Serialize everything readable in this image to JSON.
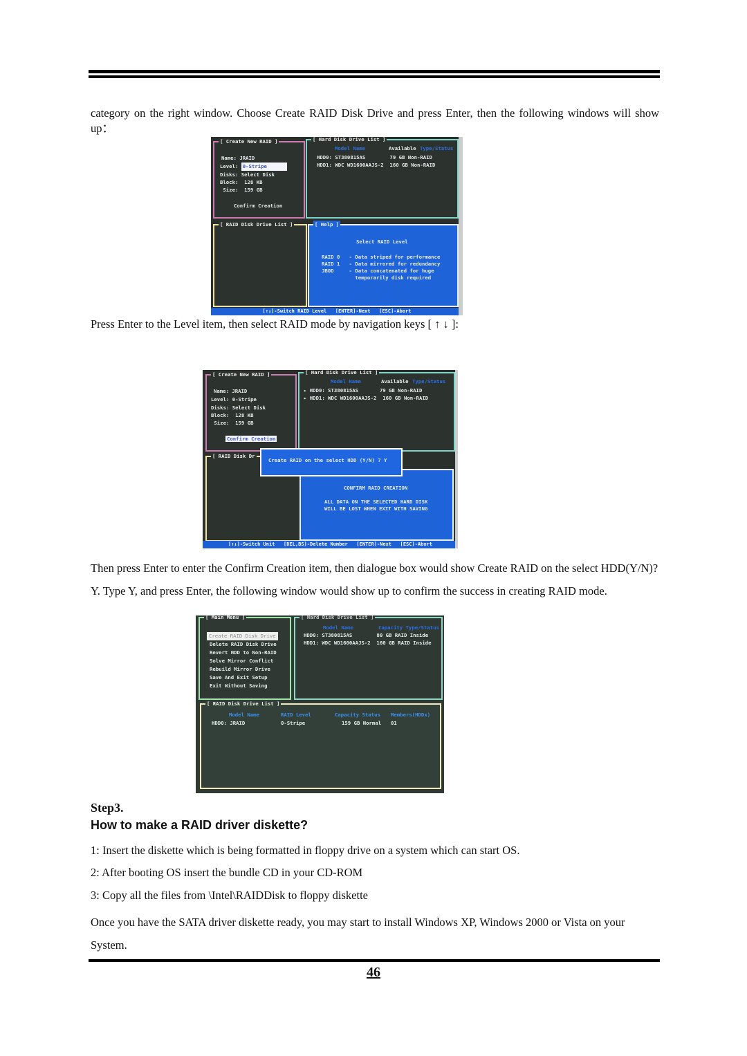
{
  "page": {
    "intro_text": "category on the right window. Choose Create RAID Disk Drive and press Enter, then the following windows will show up：",
    "caption_after_shot1": "Press Enter to the Level item, then select RAID mode by navigation keys [ ↑  ↓ ]:",
    "caption_after_shot2": "Then press Enter to enter the    Confirm Creation item, then dialogue box would show Create RAID on the select HDD(Y/N)?Y. Type Y, and press Enter, the following window would show up to confirm the success in creating RAID mode.",
    "step_label": "Step3.",
    "heading": "How to make a RAID driver diskette?",
    "steps": [
      "1: Insert the diskette which is being formatted in floppy drive on a system which can start OS.",
      "2: After booting OS insert the bundle CD in your CD-ROM",
      "3: Copy all the files from \\Intel\\RAIDDisk to floppy diskette"
    ],
    "closing_text": "Once you have the SATA driver diskette ready, you may start to install Windows XP, Windows 2000 or Vista on your System.",
    "page_number": "46"
  },
  "screenshot1": {
    "create_panel_title": "[ Create New RAID ]",
    "fields": {
      "name": "Name: JRAID",
      "level_label": "Level:",
      "level_value": "0-Stripe",
      "disks": "Disks: Select Disk",
      "block": "Block:  128 KB",
      "size": " Size:  159 GB"
    },
    "confirm": "Confirm Creation",
    "hdd_panel_title": "[ Hard Disk Drive List ]",
    "hdd_header_model": "Model Name",
    "hdd_header_available": "Available",
    "hdd_header_type": "Type/Status",
    "hdd_rows": [
      "HDD0: ST380815AS        79 GB Non-RAID",
      "HDD1: WDC WD1600AAJS-2  160 GB Non-RAID"
    ],
    "raid_list_title": "[ RAID Disk Drive List ]",
    "help_title": "[ Help ]",
    "help_heading": "Select RAID Level",
    "help_lines": [
      "RAID 0   - Data striped for performance",
      "RAID 1   - Data mirrored for redundancy",
      "JBOD     - Data concatenated for huge",
      "           temporarily disk required"
    ],
    "status": "[↑↓]-Switch RAID Level   [ENTER]-Next   [ESC]-Abort"
  },
  "screenshot2": {
    "create_panel_title": "[ Create New RAID ]",
    "fields": [
      "Name: JRAID",
      "Level: 0-Stripe",
      "Disks: Select Disk",
      "Block:  128 KB",
      " Size:  159 GB"
    ],
    "confirm": "Confirm Creation",
    "hdd_panel_title": "[ Hard Disk Drive List ]",
    "hdd_header_model": "Model Name",
    "hdd_header_available": "Available",
    "hdd_header_type": "Type/Status",
    "hdd_rows": [
      "▸ HDD0: ST380815AS       79 GB Non-RAID",
      "▸ HDD1: WDC WD1600AAJS-2  160 GB Non-RAID"
    ],
    "raid_list_title": "[ RAID Disk Dr",
    "dialog_text": "Create RAID on the select HDD (Y/N) ? Y",
    "warn_heading": "CONFIRM RAID CREATION",
    "warn_lines": [
      "ALL DATA ON THE SELECTED HARD DISK",
      "WILL BE LOST WHEN EXIT WITH SAVING"
    ],
    "status": "[↑↓]-Switch Unit   [DEL,BS]-Delete Number   [ENTER]-Next   [ESC]-Abort"
  },
  "screenshot3": {
    "main_menu_title": "[ Main Menu ]",
    "menu_items": [
      "Create RAID Disk Drive",
      "Delete RAID Disk Drive",
      "Revert HDD to Non-RAID",
      "Solve Mirror Conflict",
      "Rebuild Mirror Drive",
      "Save And Exit Setup",
      "Exit Without Saving"
    ],
    "hdd_panel_title": "[ Hard Disk Drive List ]",
    "hdd_header_model": "Model Name",
    "hdd_header_capacity": "Capacity Type/Status",
    "hdd_rows": [
      "HDD0: ST380815AS        80 GB RAID Inside",
      "HDD1: WDC WD1600AAJS-2  160 GB RAID Inside"
    ],
    "raid_list_title": "[ RAID Disk Drive List ]",
    "raid_headers": [
      "Model Name",
      "RAID Level",
      "Capacity Status",
      "Members(HDDx)"
    ],
    "raid_row": [
      "HDD0: JRAID",
      "0-Stripe",
      "159 GB Normal",
      "01"
    ]
  }
}
